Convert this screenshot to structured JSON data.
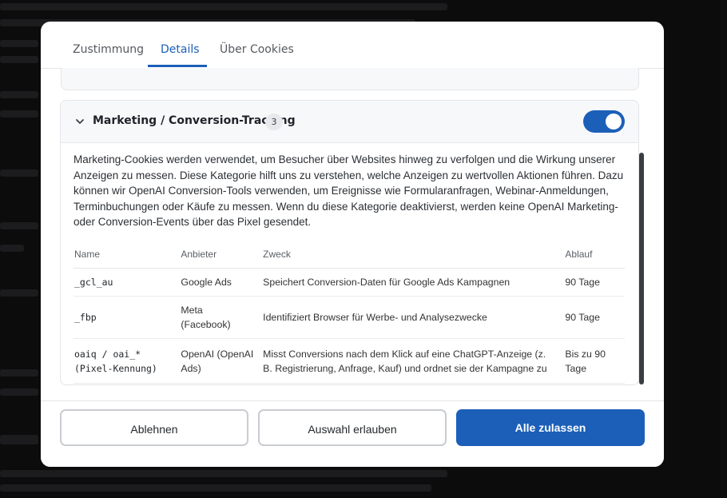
{
  "tabs": [
    {
      "label": "Zustimmung"
    },
    {
      "label": "Details"
    },
    {
      "label": "Über Cookies"
    }
  ],
  "category": {
    "title": "Marketing / Conversion-Tracking",
    "count": "3",
    "enabled": true,
    "description": "Marketing-Cookies werden verwendet, um Besucher über Websites hinweg zu verfolgen und die Wirkung unserer Anzeigen zu messen. Diese Kategorie hilft uns zu verstehen, welche Anzeigen zu wertvollen Aktionen führen. Dazu können wir OpenAI Conversion-Tools verwenden, um Ereignisse wie Formularanfragen, Webinar-Anmeldungen, Terminbuchungen oder Käufe zu messen. Wenn du diese Kategorie deaktivierst, werden keine OpenAI Marketing- oder Conversion-Events über das Pixel gesendet."
  },
  "table": {
    "headers": [
      "Name",
      "Anbieter",
      "Zweck",
      "Ablauf"
    ],
    "rows": [
      {
        "name": "_gcl_au",
        "provider": "Google Ads",
        "purpose": "Speichert Conversion-Daten für Google Ads Kampagnen",
        "expiry": "90 Tage"
      },
      {
        "name": "_fbp",
        "provider": "Meta (Facebook)",
        "purpose": "Identifiziert Browser für Werbe- und Analysezwecke",
        "expiry": "90 Tage"
      },
      {
        "name": "oaiq / oai_* (Pixel-Kennung)",
        "provider": "OpenAI (OpenAI Ads)",
        "purpose": "Misst Conversions nach dem Klick auf eine ChatGPT-Anzeige (z. B. Registrierung, Anfrage, Kauf) und ordnet sie der Kampagne zu",
        "expiry": "Bis zu 90 Tage"
      }
    ]
  },
  "buttons": {
    "reject": "Ablehnen",
    "allow_selection": "Auswahl erlauben",
    "allow_all": "Alle zulassen"
  },
  "colors": {
    "accent": "#1c5fb8",
    "overlay": "#0c0c0d"
  },
  "icons": {
    "expand": "chevron-down-icon"
  }
}
